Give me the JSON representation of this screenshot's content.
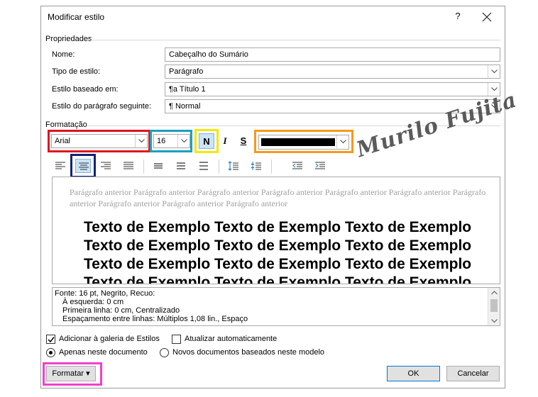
{
  "dialog": {
    "title": "Modificar estilo",
    "help": "?",
    "close": "×"
  },
  "properties": {
    "section": "Propriedades",
    "name_label": "Nome:",
    "name_value": "Cabeçalho do Sumário",
    "type_label": "Tipo de estilo:",
    "type_value": "Parágrafo",
    "based_label": "Estilo baseado em:",
    "based_value": "¶a Título 1",
    "next_label": "Estilo do parágrafo seguinte:",
    "next_value": "¶ Normal"
  },
  "formatting": {
    "section": "Formatação",
    "font": "Arial",
    "size": "16",
    "bold": "N",
    "italic": "I",
    "underline": "S",
    "font_color": "#000000"
  },
  "preview": {
    "previous_paragraph": "Parágrafo anterior Parágrafo anterior Parágrafo anterior Parágrafo anterior Parágrafo anterior Parágrafo anterior Parágrafo anterior Parágrafo anterior Parágrafo anterior Parágrafo anterior",
    "sample_lines": [
      "Texto de Exemplo Texto de Exemplo Texto de Exemplo",
      "Texto de Exemplo Texto de Exemplo Texto de Exemplo",
      "Texto de Exemplo Texto de Exemplo Texto de Exemplo",
      "Texto de Exemplo Texto de Exemplo Texto de Exemplo"
    ]
  },
  "description": {
    "lines": [
      "Fonte: 16 pt, Negrito, Recuo:",
      "À esquerda:  0 cm",
      "Primeira linha:  0 cm, Centralizado",
      "Espaçamento entre linhas:  Múltiplos 1,08 lin., Espaço"
    ]
  },
  "options": {
    "add_gallery": "Adicionar à galeria de Estilos",
    "auto_update": "Atualizar automaticamente",
    "only_doc": "Apenas neste documento",
    "new_docs": "Novos documentos baseados neste modelo"
  },
  "buttons": {
    "format": "Formatar ▾",
    "ok": "OK",
    "cancel": "Cancelar"
  },
  "watermark": "Murilo Fujita",
  "highlights": {
    "font": "#e0141e",
    "size": "#1aa0c0",
    "bold": "#f5e800",
    "color": "#f59a1a",
    "align": "#12237a",
    "format": "#f23fd0"
  }
}
